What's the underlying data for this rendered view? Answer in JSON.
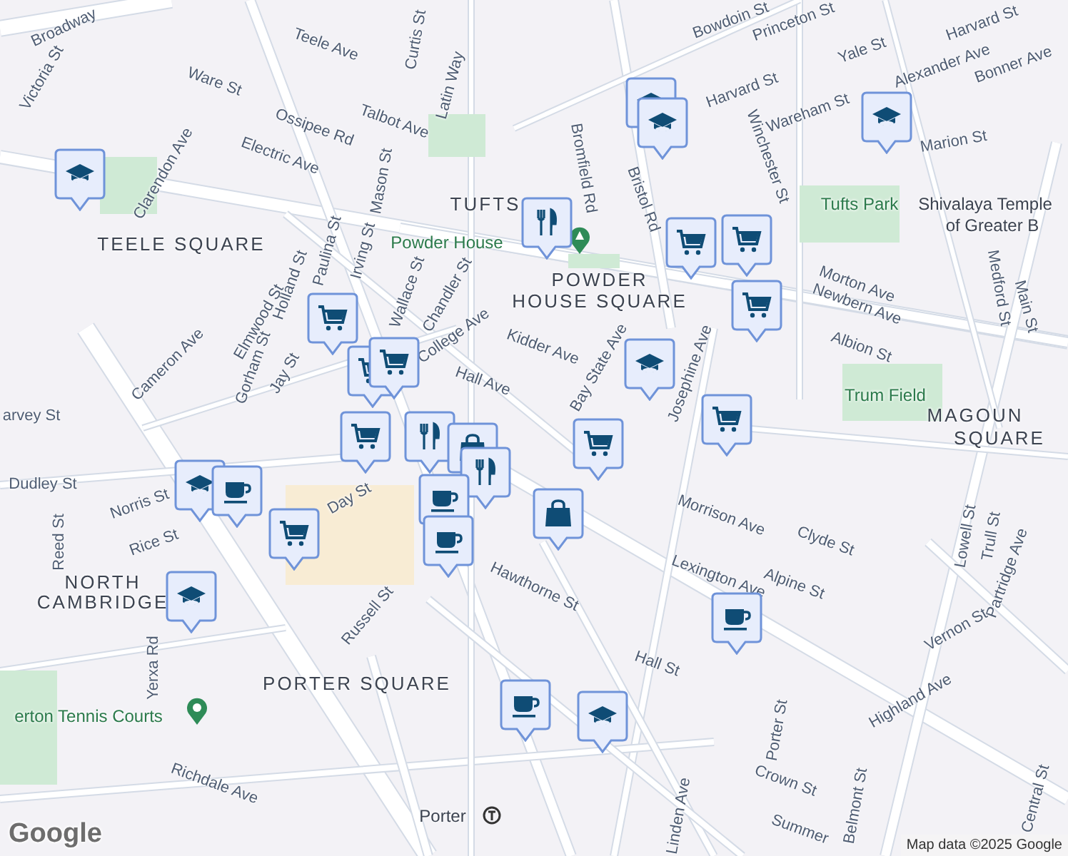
{
  "map": {
    "labels": [
      {
        "kind": "area",
        "text": "TEELE SQUARE"
      },
      {
        "kind": "area",
        "text": "TUFTS"
      },
      {
        "kind": "area",
        "text": "POWDER"
      },
      {
        "kind": "area",
        "text": "HOUSE SQUARE"
      },
      {
        "kind": "area",
        "text": "NORTH"
      },
      {
        "kind": "area",
        "text": "CAMBRIDGE"
      },
      {
        "kind": "area",
        "text": "PORTER SQUARE"
      },
      {
        "kind": "area",
        "text": "MAGOUN"
      },
      {
        "kind": "area",
        "text": "SQUARE"
      },
      {
        "kind": "park",
        "text": "Tufts Park"
      },
      {
        "kind": "park",
        "text": "Trum Field"
      },
      {
        "kind": "place",
        "text": "Shivalaya Temple"
      },
      {
        "kind": "place",
        "text": "of Greater B"
      },
      {
        "kind": "park",
        "text": "Powder House"
      },
      {
        "kind": "park",
        "text": "erton Tennis Courts"
      },
      {
        "kind": "place",
        "text": "Porter"
      },
      {
        "kind": "street",
        "text": "Broadway"
      },
      {
        "kind": "street",
        "text": "Victoria St"
      },
      {
        "kind": "street",
        "text": "Ware St"
      },
      {
        "kind": "street",
        "text": "Teele Ave"
      },
      {
        "kind": "street",
        "text": "Curtis St"
      },
      {
        "kind": "street",
        "text": "Latin Way"
      },
      {
        "kind": "street",
        "text": "Talbot Ave"
      },
      {
        "kind": "street",
        "text": "Ossipee Rd"
      },
      {
        "kind": "street",
        "text": "Electric Ave"
      },
      {
        "kind": "street",
        "text": "Clarendon Ave"
      },
      {
        "kind": "street",
        "text": "Mason St"
      },
      {
        "kind": "street",
        "text": "Irving St"
      },
      {
        "kind": "street",
        "text": "Wallace St"
      },
      {
        "kind": "street",
        "text": "Chandler St"
      },
      {
        "kind": "street",
        "text": "Paulina St"
      },
      {
        "kind": "street",
        "text": "Holland St"
      },
      {
        "kind": "street",
        "text": "Elmwood St"
      },
      {
        "kind": "street",
        "text": "Cameron Ave"
      },
      {
        "kind": "street",
        "text": "Gorham St"
      },
      {
        "kind": "street",
        "text": "Jay St"
      },
      {
        "kind": "street",
        "text": "College Ave"
      },
      {
        "kind": "street",
        "text": "Kidder Ave"
      },
      {
        "kind": "street",
        "text": "Hall Ave"
      },
      {
        "kind": "street",
        "text": "Bay State Ave"
      },
      {
        "kind": "street",
        "text": "Bromfield Rd"
      },
      {
        "kind": "street",
        "text": "Bristol Rd"
      },
      {
        "kind": "street",
        "text": "Winchester St"
      },
      {
        "kind": "street",
        "text": "Josephine Ave"
      },
      {
        "kind": "street",
        "text": "Morrison Ave"
      },
      {
        "kind": "street",
        "text": "Clyde St"
      },
      {
        "kind": "street",
        "text": "Day St"
      },
      {
        "kind": "street",
        "text": "arvey St"
      },
      {
        "kind": "street",
        "text": "Norris St"
      },
      {
        "kind": "street",
        "text": "Rice St"
      },
      {
        "kind": "street",
        "text": "Reed St"
      },
      {
        "kind": "street",
        "text": "Hawthorne St"
      },
      {
        "kind": "street",
        "text": "Lexington Ave"
      },
      {
        "kind": "street",
        "text": "Alpine St"
      },
      {
        "kind": "street",
        "text": "Russell St"
      },
      {
        "kind": "street",
        "text": "Hall St"
      },
      {
        "kind": "street",
        "text": "Highland Ave"
      },
      {
        "kind": "street",
        "text": "Porter St"
      },
      {
        "kind": "street",
        "text": "Crown St"
      },
      {
        "kind": "street",
        "text": "Belmont St"
      },
      {
        "kind": "street",
        "text": "Linden Ave"
      },
      {
        "kind": "street",
        "text": "Richdale Ave"
      },
      {
        "kind": "street",
        "text": "Yerxa Rd"
      },
      {
        "kind": "street",
        "text": "Lowell St"
      },
      {
        "kind": "street",
        "text": "Trull St"
      },
      {
        "kind": "street",
        "text": "Partridge Ave"
      },
      {
        "kind": "street",
        "text": "Vernon St"
      },
      {
        "kind": "street",
        "text": "Medford St"
      },
      {
        "kind": "street",
        "text": "Main St"
      },
      {
        "kind": "street",
        "text": "Morton Ave"
      },
      {
        "kind": "street",
        "text": "Newbern Ave"
      },
      {
        "kind": "street",
        "text": "Albion St"
      },
      {
        "kind": "street",
        "text": "Marion St"
      },
      {
        "kind": "street",
        "text": "Wareham St"
      },
      {
        "kind": "street",
        "text": "Alexander Ave"
      },
      {
        "kind": "street",
        "text": "Harvard St"
      },
      {
        "kind": "street",
        "text": "Harvard St"
      },
      {
        "kind": "street",
        "text": "Bonner Ave"
      },
      {
        "kind": "street",
        "text": "Yale St"
      },
      {
        "kind": "street",
        "text": "Princeton St"
      },
      {
        "kind": "street",
        "text": "Bowdoin St"
      },
      {
        "kind": "street",
        "text": "Central St"
      },
      {
        "kind": "street",
        "text": "Summer"
      },
      {
        "kind": "street",
        "text": "Dudley St"
      }
    ],
    "markers": [
      {
        "kind": "school"
      },
      {
        "kind": "school"
      },
      {
        "kind": "school"
      },
      {
        "kind": "school"
      },
      {
        "kind": "school"
      },
      {
        "kind": "school"
      },
      {
        "kind": "school"
      },
      {
        "kind": "school"
      },
      {
        "kind": "cart"
      },
      {
        "kind": "cart"
      },
      {
        "kind": "cart"
      },
      {
        "kind": "cart"
      },
      {
        "kind": "cart"
      },
      {
        "kind": "cart"
      },
      {
        "kind": "cart"
      },
      {
        "kind": "cart"
      },
      {
        "kind": "cart"
      },
      {
        "kind": "cart"
      },
      {
        "kind": "food"
      },
      {
        "kind": "food"
      },
      {
        "kind": "bag"
      },
      {
        "kind": "food"
      },
      {
        "kind": "bag"
      },
      {
        "kind": "coffee"
      },
      {
        "kind": "coffee"
      },
      {
        "kind": "coffee"
      },
      {
        "kind": "coffee"
      },
      {
        "kind": "coffee"
      }
    ]
  },
  "google_logo": "Google",
  "attribution": "Map data ©2025 Google"
}
